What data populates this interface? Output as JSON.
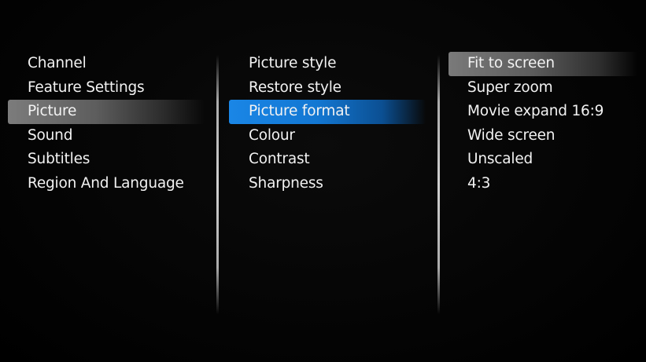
{
  "menu": {
    "main": [
      {
        "label": "Channel"
      },
      {
        "label": "Feature Settings"
      },
      {
        "label": "Picture"
      },
      {
        "label": "Sound"
      },
      {
        "label": "Subtitles"
      },
      {
        "label": "Region And Language"
      }
    ],
    "picture": [
      {
        "label": "Picture style"
      },
      {
        "label": "Restore style"
      },
      {
        "label": "Picture format"
      },
      {
        "label": "Colour"
      },
      {
        "label": "Contrast"
      },
      {
        "label": "Sharpness"
      }
    ],
    "picture_format": [
      {
        "label": "Fit to screen"
      },
      {
        "label": "Super zoom"
      },
      {
        "label": "Movie expand 16:9"
      },
      {
        "label": "Wide screen"
      },
      {
        "label": "Unscaled"
      },
      {
        "label": "4:3"
      }
    ]
  },
  "colors": {
    "background": "#000000",
    "text": "#f2f2f2",
    "focus_blue": "#1a86e6",
    "selection_grey": "#7c7c7c"
  }
}
